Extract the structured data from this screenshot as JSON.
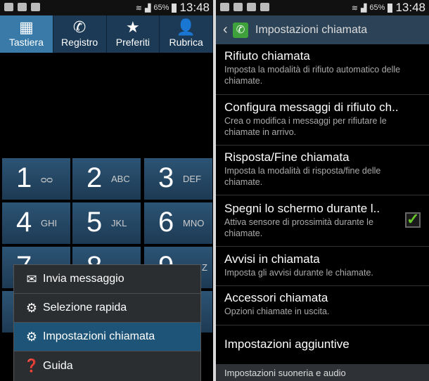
{
  "status": {
    "battery": "65%",
    "time": "13:48"
  },
  "dialer": {
    "tabs": [
      {
        "label": "Tastiera",
        "icon": "keypad-icon",
        "active": true
      },
      {
        "label": "Registro",
        "icon": "call-log-icon"
      },
      {
        "label": "Preferiti",
        "icon": "star-icon"
      },
      {
        "label": "Rubrica",
        "icon": "contact-icon"
      }
    ],
    "keys": [
      {
        "digit": "1",
        "letters": "QO"
      },
      {
        "digit": "2",
        "letters": "ABC"
      },
      {
        "digit": "3",
        "letters": "DEF"
      },
      {
        "digit": "4",
        "letters": "GHI"
      },
      {
        "digit": "5",
        "letters": "JKL"
      },
      {
        "digit": "6",
        "letters": "MNO"
      },
      {
        "digit": "7",
        "letters": ""
      },
      {
        "digit": "8",
        "letters": ""
      },
      {
        "digit": "9",
        "letters": "Z"
      }
    ],
    "menu": [
      {
        "label": "Invia messaggio",
        "icon": "send-message-icon"
      },
      {
        "label": "Selezione rapida",
        "icon": "speed-dial-icon"
      },
      {
        "label": "Impostazioni chiamata",
        "icon": "gear-icon",
        "selected": true
      },
      {
        "label": "Guida",
        "icon": "help-icon"
      }
    ]
  },
  "settings": {
    "title": "Impostazioni chiamata",
    "items": [
      {
        "title": "Rifiuto chiamata",
        "subtitle": "Imposta la modalità di rifiuto automatico delle chiamate."
      },
      {
        "title": "Configura messaggi di rifiuto ch..",
        "subtitle": "Crea o modifica i messaggi per rifiutare le chiamate in arrivo."
      },
      {
        "title": "Risposta/Fine chiamata",
        "subtitle": "Imposta la modalità di risposta/fine delle chiamate."
      },
      {
        "title": "Spegni lo schermo durante l..",
        "subtitle": "Attiva sensore di prossimità durante le chiamate.",
        "checked": true
      },
      {
        "title": "Avvisi in chiamata",
        "subtitle": "Imposta gli avvisi durante le chiamate."
      },
      {
        "title": "Accessori chiamata",
        "subtitle": "Opzioni chiamate in uscita."
      },
      {
        "title": "Impostazioni aggiuntive",
        "subtitle": ""
      }
    ],
    "section": "Impostazioni suoneria e audio"
  }
}
